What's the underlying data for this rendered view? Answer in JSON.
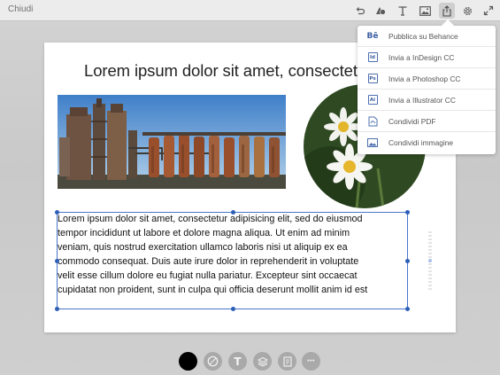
{
  "topbar": {
    "close_label": "Chiudi",
    "icons": [
      "undo-icon",
      "shape-icon",
      "text-icon",
      "image-icon",
      "share-icon",
      "settings-icon",
      "expand-icon"
    ]
  },
  "document": {
    "title": "Lorem ipsum dolor sit amet, consectetur",
    "images": [
      "industrial-plant-photo",
      "daisy-flowers-photo"
    ],
    "body_lines": [
      "Lorem ipsum dolor sit amet, consectetur adipisicing elit, sed do eiusmod",
      "tempor incididunt ut labore et dolore magna aliqua. Ut enim ad minim",
      "veniam, quis nostrud exercitation ullamco laboris nisi ut aliquip ex ea",
      "commodo consequat. Duis aute irure dolor in reprehenderit in voluptate",
      "velit esse cillum dolore eu fugiat nulla pariatur. Excepteur sint occaecat",
      "cupidatat non proident, sunt in culpa qui officia deserunt mollit anim id est"
    ]
  },
  "share_menu": {
    "items": [
      {
        "label": "Pubblica su Behance",
        "icon": "behance-icon",
        "glyph": "Bē"
      },
      {
        "label": "Invia a InDesign CC",
        "icon": "indesign-icon",
        "glyph": "Id"
      },
      {
        "label": "Invia a Photoshop CC",
        "icon": "photoshop-icon",
        "glyph": "Ps"
      },
      {
        "label": "Invia a Illustrator CC",
        "icon": "illustrator-icon",
        "glyph": "Ai"
      },
      {
        "label": "Condividi PDF",
        "icon": "pdf-icon"
      },
      {
        "label": "Condividi immagine",
        "icon": "share-image-icon"
      }
    ]
  },
  "bottom_toolbar": {
    "items": [
      "color-swatch",
      "style-icon",
      "text-style-icon",
      "layers-icon",
      "page-icon",
      "more-icon"
    ],
    "t_glyph": "T",
    "more_glyph": "•••"
  },
  "colors": {
    "accent": "#2d5fb8",
    "selected_color": "#000000",
    "menu_icon_blue": "#4d6fb0"
  }
}
